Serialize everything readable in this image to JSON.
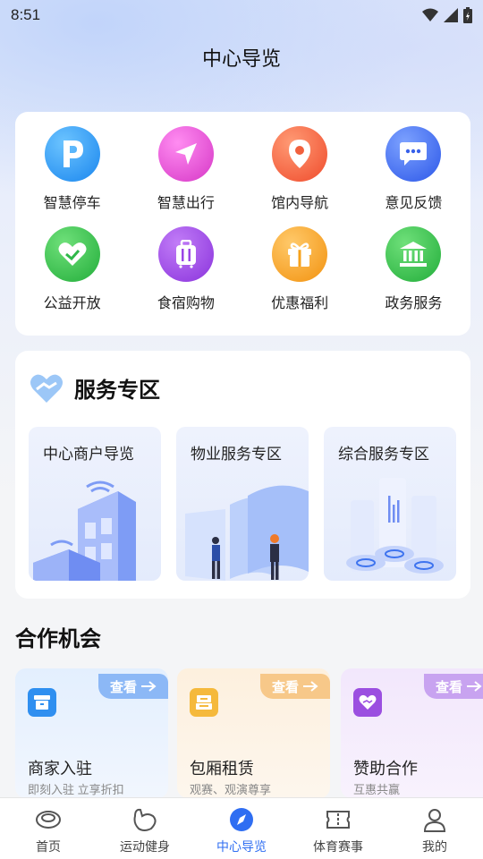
{
  "status": {
    "time": "8:51"
  },
  "header": {
    "title": "中心导览"
  },
  "grid": {
    "items": [
      {
        "label": "智慧停车",
        "icon": "parking-icon",
        "color": "#2b9bf4"
      },
      {
        "label": "智慧出行",
        "icon": "navigation-arrow-icon",
        "color": "#e64fd3"
      },
      {
        "label": "馆内导航",
        "icon": "location-pin-icon",
        "color": "#f45b38"
      },
      {
        "label": "意见反馈",
        "icon": "chat-bubble-icon",
        "color": "#3f6ef3"
      },
      {
        "label": "公益开放",
        "icon": "heart-hand-icon",
        "color": "#35c24a"
      },
      {
        "label": "食宿购物",
        "icon": "luggage-icon",
        "color": "#9a45e6"
      },
      {
        "label": "优惠福利",
        "icon": "gift-icon",
        "color": "#f6a11b"
      },
      {
        "label": "政务服务",
        "icon": "government-building-icon",
        "color": "#2fb84a"
      }
    ]
  },
  "service": {
    "title": "服务专区",
    "tiles": [
      {
        "label": "中心商户导览"
      },
      {
        "label": "物业服务专区"
      },
      {
        "label": "综合服务专区"
      }
    ]
  },
  "cooperation": {
    "title": "合作机会",
    "cards": [
      {
        "tag": "查看",
        "name": "商家入驻",
        "sub": "即刻入驻 立享折扣",
        "icon": "shop-icon",
        "color": "#2f8ff0"
      },
      {
        "tag": "查看",
        "name": "包厢租赁",
        "sub": "观赛、观演尊享",
        "icon": "box-room-icon",
        "color": "#f5b93c"
      },
      {
        "tag": "查看",
        "name": "赞助合作",
        "sub": "互惠共赢",
        "icon": "handshake-heart-icon",
        "color": "#9b4fe0"
      }
    ]
  },
  "tabbar": {
    "tabs": [
      {
        "label": "首页",
        "icon": "home-icon"
      },
      {
        "label": "运动健身",
        "icon": "fitness-icon"
      },
      {
        "label": "中心导览",
        "icon": "compass-icon",
        "active": true
      },
      {
        "label": "体育赛事",
        "icon": "ticket-icon"
      },
      {
        "label": "我的",
        "icon": "profile-icon"
      }
    ]
  },
  "colors": {
    "accent": "#2f6ef2"
  }
}
